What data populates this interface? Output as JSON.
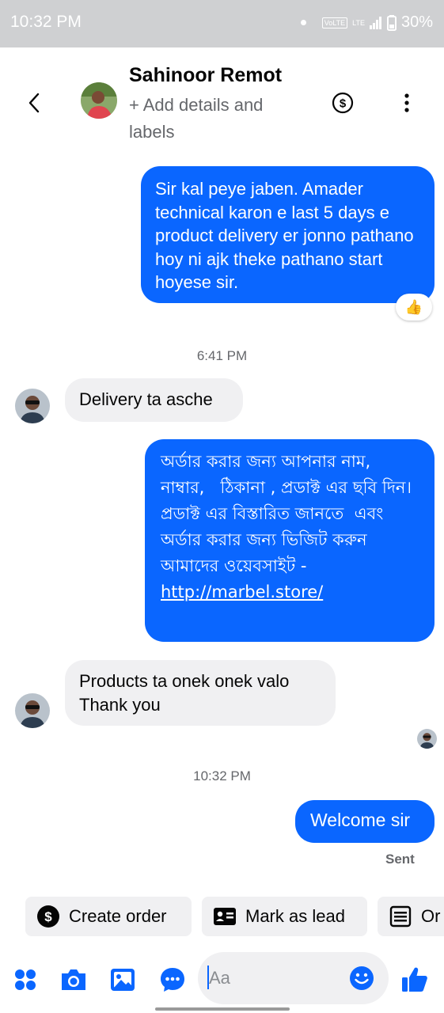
{
  "status_bar": {
    "time": "10:32 PM",
    "volte": "VoLTE",
    "lte": "LTE",
    "battery": "30%"
  },
  "header": {
    "contact_name": "Sahinoor Remot",
    "subtitle": "+ Add details and labels"
  },
  "messages": [
    {
      "direction": "outgoing",
      "text": "Sir kal peye jaben. Amader technical karon e last 5 days e product delivery er jonno pathano hoy ni ajk theke pathano start hoyese sir.",
      "reaction": "👍"
    },
    {
      "direction": "timestamp",
      "text": "6:41 PM"
    },
    {
      "direction": "incoming",
      "text": "Delivery ta asche"
    },
    {
      "direction": "outgoing",
      "text": "অর্ডার করার জন্য আপনার নাম, নাম্বার,   ঠিকানা , প্রডাক্ট এর ছবি দিন।\nপ্রডাক্ট এর বিস্তারিত জানতে  এবং অর্ডার করার জন্য ভিজিট করুন আমাদের ওয়েবসাইট - ",
      "link": "http://marbel.store/"
    },
    {
      "direction": "incoming",
      "text": "Products ta onek onek valo\nThank you"
    },
    {
      "direction": "timestamp",
      "text": "10:32 PM"
    },
    {
      "direction": "outgoing",
      "text": "Welcome sir",
      "status": "Sent"
    }
  ],
  "quick_actions": [
    "Create order",
    "Mark as lead",
    "Or"
  ],
  "composer": {
    "placeholder": "Aa"
  },
  "colors": {
    "accent": "#0a66ff",
    "incoming_bubble": "#f0f0f2",
    "secondary_text": "#65676b"
  },
  "icons": [
    "back-icon",
    "dollar-icon",
    "more-vertical-icon",
    "thumbs-up-icon",
    "menu-dots-icon",
    "camera-icon",
    "gallery-icon",
    "chat-bubble-icon",
    "emoji-icon",
    "like-icon",
    "id-card-icon",
    "list-icon"
  ]
}
